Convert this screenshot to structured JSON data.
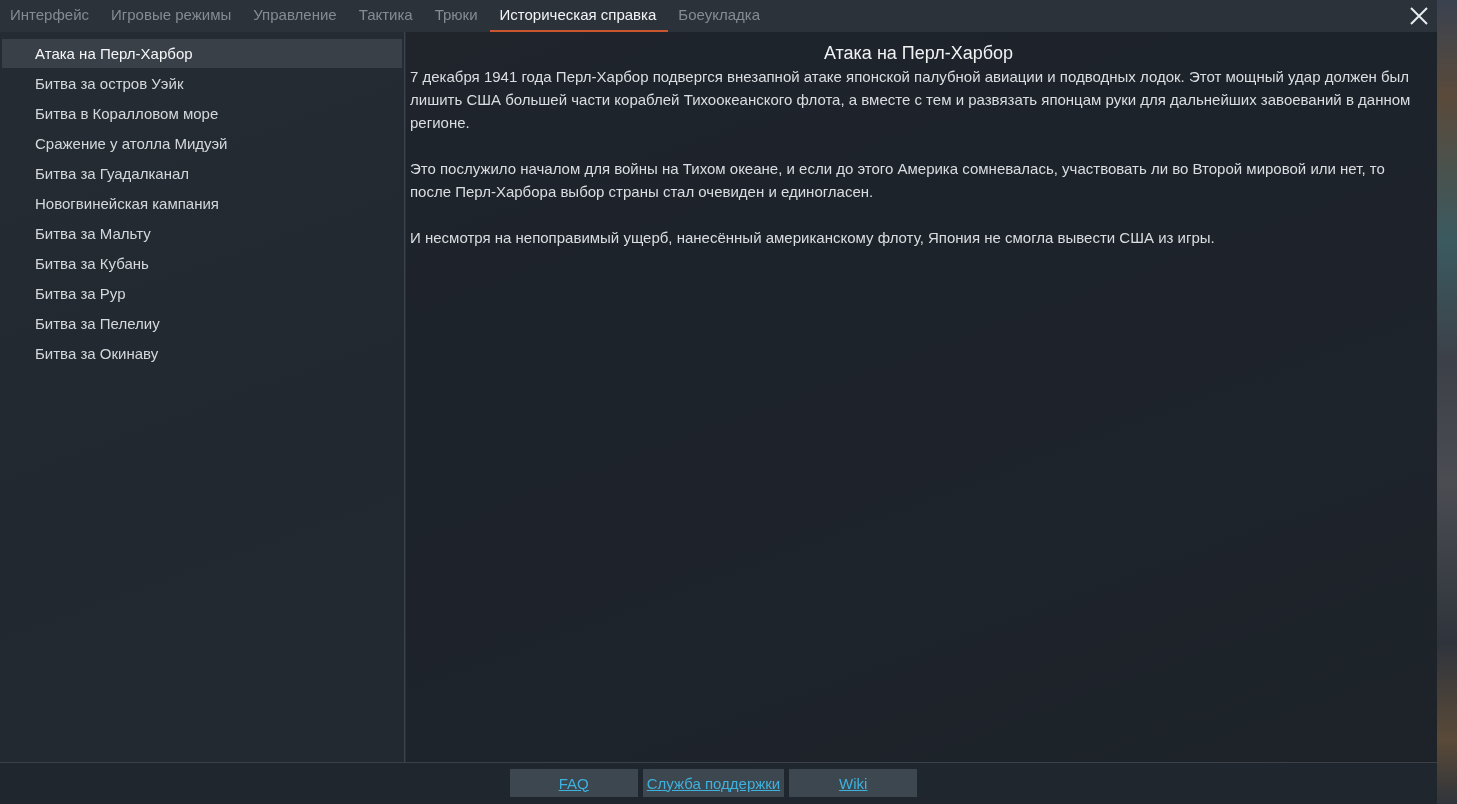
{
  "tabs": [
    {
      "label": "Интерфейс",
      "selected": false
    },
    {
      "label": "Игровые режимы",
      "selected": false
    },
    {
      "label": "Управление",
      "selected": false
    },
    {
      "label": "Тактика",
      "selected": false
    },
    {
      "label": "Трюки",
      "selected": false
    },
    {
      "label": "Историческая справка",
      "selected": true
    },
    {
      "label": "Боеукладка",
      "selected": false
    }
  ],
  "sidebar": {
    "items": [
      {
        "label": "Атака на Перл-Харбор",
        "selected": true
      },
      {
        "label": "Битва за остров Уэйк",
        "selected": false
      },
      {
        "label": "Битва в Коралловом море",
        "selected": false
      },
      {
        "label": "Сражение у атолла Мидуэй",
        "selected": false
      },
      {
        "label": "Битва за Гуадалканал",
        "selected": false
      },
      {
        "label": "Новогвинейская кампания",
        "selected": false
      },
      {
        "label": "Битва за Мальту",
        "selected": false
      },
      {
        "label": "Битва за Кубань",
        "selected": false
      },
      {
        "label": "Битва за Рур",
        "selected": false
      },
      {
        "label": "Битва за Пелелиу",
        "selected": false
      },
      {
        "label": "Битва за Окинаву",
        "selected": false
      }
    ]
  },
  "article": {
    "title": "Атака на Перл-Харбор",
    "paragraphs": [
      "7 декабря 1941 года Перл-Харбор подвергся внезапной атаке японской палубной авиации и подводных лодок. Этот мощный удар должен был лишить США большей части кораблей Тихоокеанского флота, а вместе с тем и развязать японцам руки для дальнейших завоеваний в данном регионе.",
      "Это послужило началом для войны на Тихом океане, и если до этого Америка сомневалась, участвовать ли во Второй мировой или нет, то после Перл-Харбора выбор страны стал очевиден и единогласен.",
      "И несмотря на непоправимый ущерб, нанесённый американскому флоту, Япония не смогла вывести США из игры."
    ]
  },
  "footer_links": [
    "FAQ",
    "Служба поддержки",
    "Wiki"
  ]
}
